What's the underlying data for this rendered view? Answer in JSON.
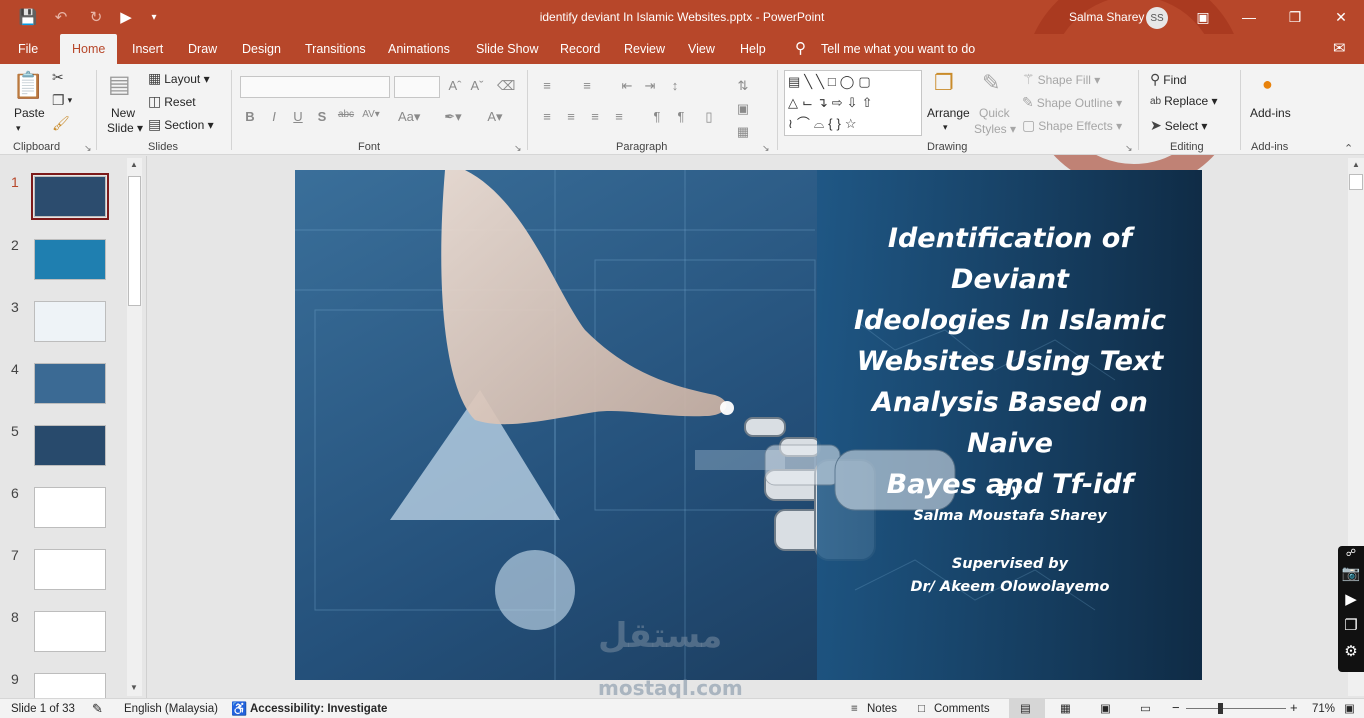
{
  "app": {
    "document_title": "identify deviant In Islamic Websites.pptx  -  PowerPoint",
    "user_name": "Salma Sharey",
    "user_initials": "SS",
    "accent": "#b7472a"
  },
  "tabs": [
    "File",
    "Home",
    "Insert",
    "Draw",
    "Design",
    "Transitions",
    "Animations",
    "Slide Show",
    "Record",
    "Review",
    "View",
    "Help"
  ],
  "tell_me": "Tell me what you want to do",
  "ribbon": {
    "clipboard": {
      "paste": "Paste",
      "label": "Clipboard"
    },
    "slides": {
      "new_slide_1": "New",
      "new_slide_2": "Slide ▾",
      "layout": "Layout ▾",
      "reset": "Reset",
      "section": "Section ▾",
      "label": "Slides"
    },
    "font": {
      "label": "Font"
    },
    "paragraph": {
      "label": "Paragraph"
    },
    "drawing": {
      "arrange": "Arrange",
      "quick_styles_1": "Quick",
      "quick_styles_2": "Styles ▾",
      "shape_fill": "Shape Fill ▾",
      "shape_outline": "Shape Outline ▾",
      "shape_effects": "Shape Effects ▾",
      "label": "Drawing"
    },
    "editing": {
      "find": "Find",
      "replace": "Replace ▾",
      "select": "Select ▾",
      "label": "Editing"
    },
    "addins": {
      "button": "Add-ins",
      "label": "Add-ins"
    }
  },
  "thumbnails": [
    {
      "num": "1",
      "color": "#2c4c6e",
      "selected": true
    },
    {
      "num": "2",
      "color": "#1f7fb0",
      "selected": false
    },
    {
      "num": "3",
      "color": "#eef3f7",
      "selected": false
    },
    {
      "num": "4",
      "color": "#3b6a94",
      "selected": false
    },
    {
      "num": "5",
      "color": "#284a6c",
      "selected": false
    },
    {
      "num": "6",
      "color": "#ffffff",
      "selected": false
    },
    {
      "num": "7",
      "color": "#ffffff",
      "selected": false
    },
    {
      "num": "8",
      "color": "#ffffff",
      "selected": false
    },
    {
      "num": "9",
      "color": "#ffffff",
      "selected": false
    }
  ],
  "slide": {
    "title_lines": [
      "Identification of Deviant",
      "Ideologies In Islamic",
      "Websites Using Text",
      "Analysis Based on Naive",
      "Bayes and Tf-idf"
    ],
    "by": "By",
    "author": "Salma Moustafa Sharey",
    "supervised": "Supervised by",
    "supervisor": "Dr/ Akeem Olowolayemo"
  },
  "watermark": {
    "arabic": "مستقل",
    "latin": "mostaql.com"
  },
  "status": {
    "slide_counter": "Slide 1 of 33",
    "language": "English (Malaysia)",
    "accessibility": "Accessibility: Investigate",
    "notes": "Notes",
    "comments": "Comments",
    "zoom": "71%"
  }
}
